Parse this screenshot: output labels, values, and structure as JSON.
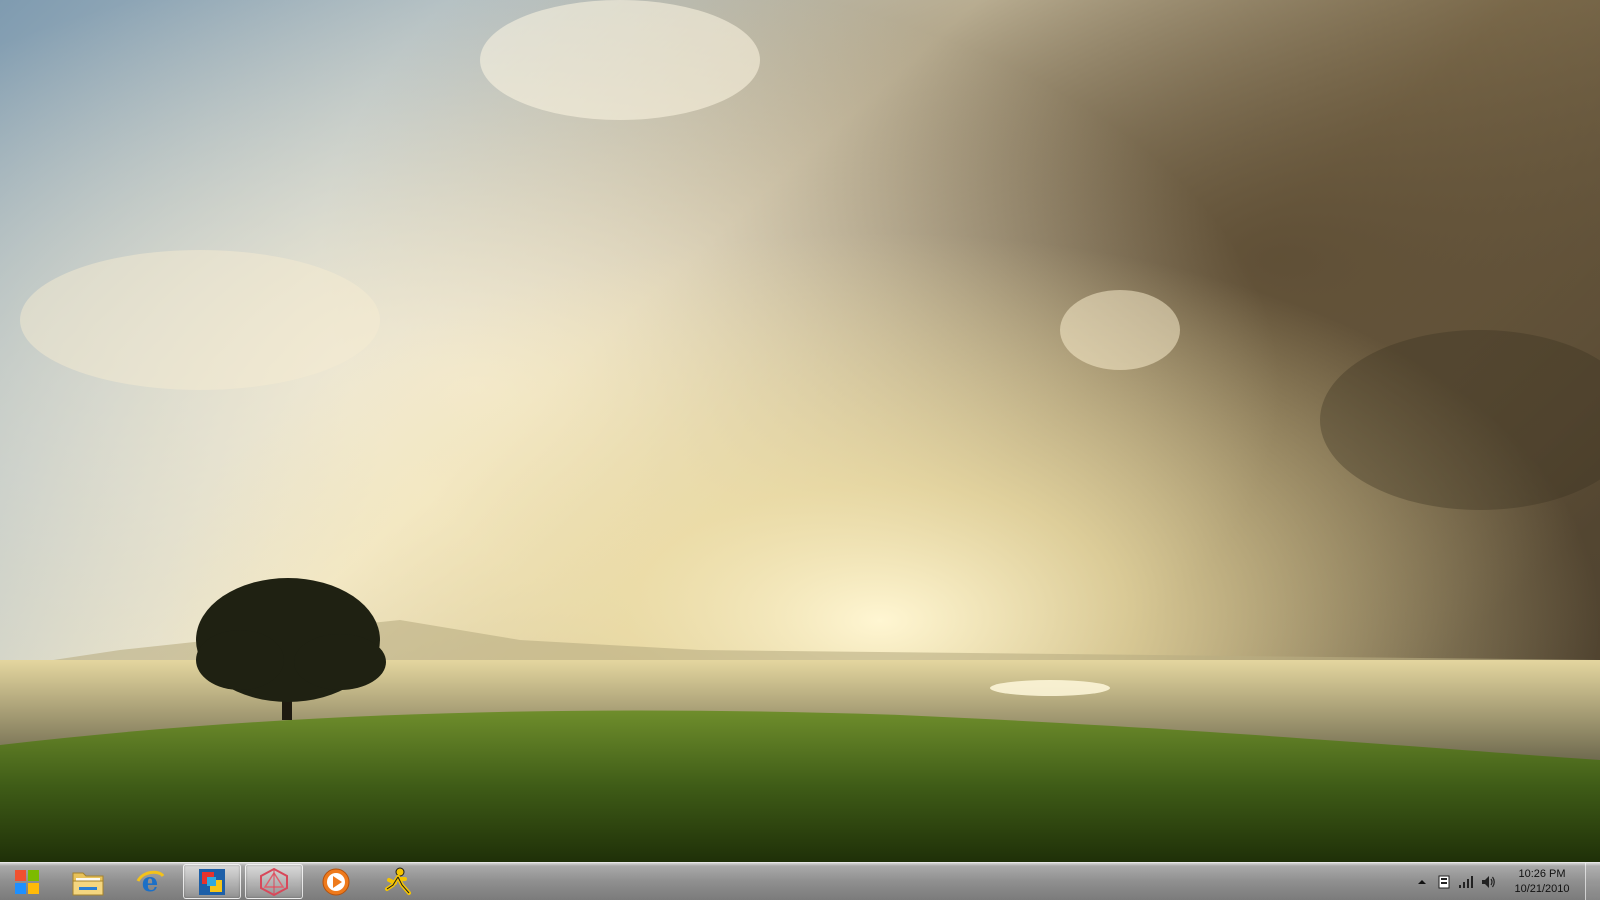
{
  "desktop": {
    "wallpaper": "tree-on-hill-under-clouds"
  },
  "taskbar": {
    "start_button": {
      "icon": "windows-logo-icon"
    },
    "pinned": [
      {
        "name": "explorer",
        "icon": "folder-icon",
        "active": false
      },
      {
        "name": "internet-explorer",
        "icon": "ie-icon",
        "active": false
      },
      {
        "name": "windows-live",
        "icon": "tiles-app-icon",
        "active": true
      },
      {
        "name": "zune",
        "icon": "zune-icon",
        "active": true
      },
      {
        "name": "media-player",
        "icon": "play-icon",
        "active": false
      },
      {
        "name": "aim",
        "icon": "aim-running-man-icon",
        "active": false
      }
    ],
    "tray": {
      "icons": [
        "show-hidden-chevron-icon",
        "action-center-icon",
        "network-signal-icon",
        "volume-icon"
      ],
      "time": "10:26 PM",
      "date": "10/21/2010"
    }
  }
}
